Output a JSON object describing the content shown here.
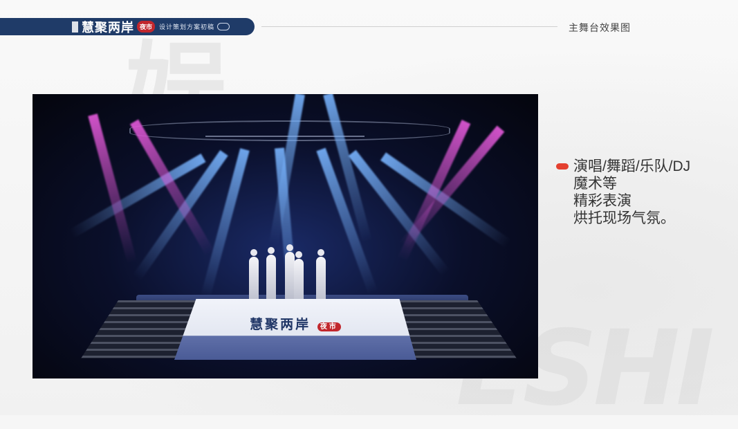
{
  "header": {
    "logo_title": "慧聚两岸",
    "logo_seal": "夜市",
    "logo_subtitle": "设计策划方案初稿",
    "section_title": "主舞台效果图"
  },
  "background": {
    "big_char": "娱"
  },
  "render": {
    "screen_title": "慧聚两岸",
    "screen_seal": "夜市"
  },
  "bullet": {
    "lines": [
      "演唱/舞蹈/乐队/DJ",
      "魔术等",
      "精彩表演",
      "烘托现场气氛。"
    ]
  },
  "colors": {
    "brand_navy": "#1f3b68",
    "accent_red": "#e4402f"
  }
}
